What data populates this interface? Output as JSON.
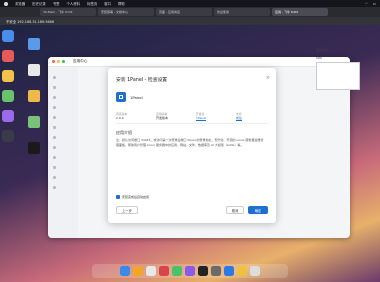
{
  "menubar": {
    "items": [
      "浏览器",
      "历史记录",
      "书签",
      "个人资料",
      "标签页",
      "窗口",
      "帮助"
    ]
  },
  "tabs": [
    {
      "label": "3X-Mark - 飞牛 fnOS"
    },
    {
      "label": "安装部署 - 文档中心"
    },
    {
      "label": "页面 - 应用商店"
    },
    {
      "label": "欢迎使用"
    },
    {
      "label": "应用 - 飞牛 fnOS"
    }
  ],
  "urlbar": {
    "value": "不安全 192.168.31.189:5666"
  },
  "window": {
    "title": "应用中心"
  },
  "sidebar": {
    "items": [
      "",
      "",
      "",
      "",
      "",
      "",
      "",
      "",
      "",
      "",
      "",
      "",
      "",
      ""
    ]
  },
  "modal": {
    "title": "安装 1Panel - 检查设置",
    "close": "×",
    "app_name": "1Panel",
    "meta": [
      {
        "label": "所需版本",
        "value": "2.0.0"
      },
      {
        "label": "应用版本",
        "value": "开发版本"
      },
      {
        "label": "开发商",
        "value": "1Panel"
      },
      {
        "label": "支持",
        "value": "前往"
      }
    ],
    "section_title": "应用介绍",
    "description": "注：默认访问端口 34945，或访问第一次登录后端口 Panel 的登录地址，现代化、开源的 Linux 服务器运维管理面板，帮助用户管理 Linux 服务器中的应用、网站、文件、数据库及 AI 大模型（LLMs）等。",
    "agree_label": "安装完成后自动启用",
    "btn_back": "上一步",
    "btn_cancel": "取消",
    "btn_confirm": "确定"
  },
  "right_panel": {
    "label1": "运行状态",
    "label2": "CPU"
  },
  "colors": {
    "accent": "#1f6fd1",
    "menubar": "#15161b"
  }
}
